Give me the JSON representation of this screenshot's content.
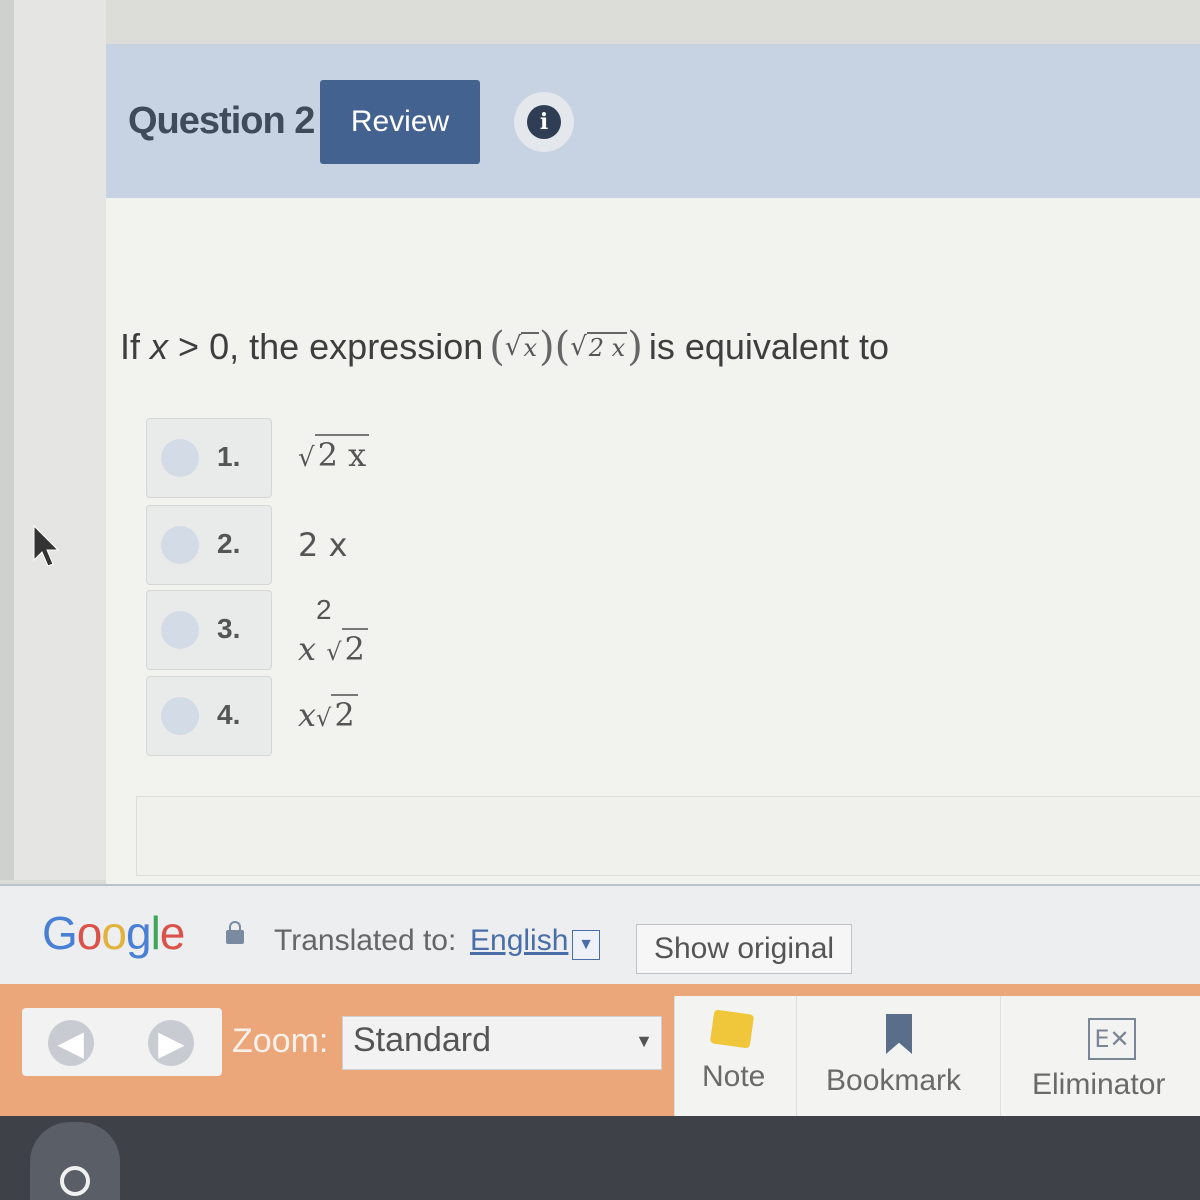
{
  "question": {
    "title": "Question 2",
    "review_label": "Review",
    "info_icon": "i",
    "text_prefix": "If",
    "variable": "x",
    "condition": "> 0, the expression",
    "expr_radicand_1": "x",
    "expr_radicand_2": "2 x",
    "text_suffix": "is equivalent to"
  },
  "choices": [
    {
      "number": "1.",
      "answer_radicand": "2 x"
    },
    {
      "number": "2.",
      "answer_text": "2 x"
    },
    {
      "number": "3.",
      "answer_sup": "2",
      "answer_base": "x",
      "answer_radicand": "2"
    },
    {
      "number": "4.",
      "answer_base": "x",
      "answer_radicand": "2"
    }
  ],
  "translate_bar": {
    "brand": [
      "G",
      "o",
      "o",
      "g",
      "l",
      "e"
    ],
    "translated_to": "Translated to:",
    "language": "English",
    "dropdown_glyph": "▼",
    "show_original": "Show original"
  },
  "toolbar": {
    "back_glyph": "◀",
    "forward_glyph": "▶",
    "zoom_label": "Zoom:",
    "zoom_value": "Standard",
    "zoom_arrow": "▼",
    "note_label": "Note",
    "bookmark_label": "Bookmark",
    "eliminator_label": "Eliminator",
    "eliminator_glyph": "E✕"
  },
  "colors": {
    "header_bg": "#c7d2e2",
    "review_btn": "#44628f",
    "toolbar_orange": "#eba77a",
    "link_blue": "#4a6ea8"
  }
}
